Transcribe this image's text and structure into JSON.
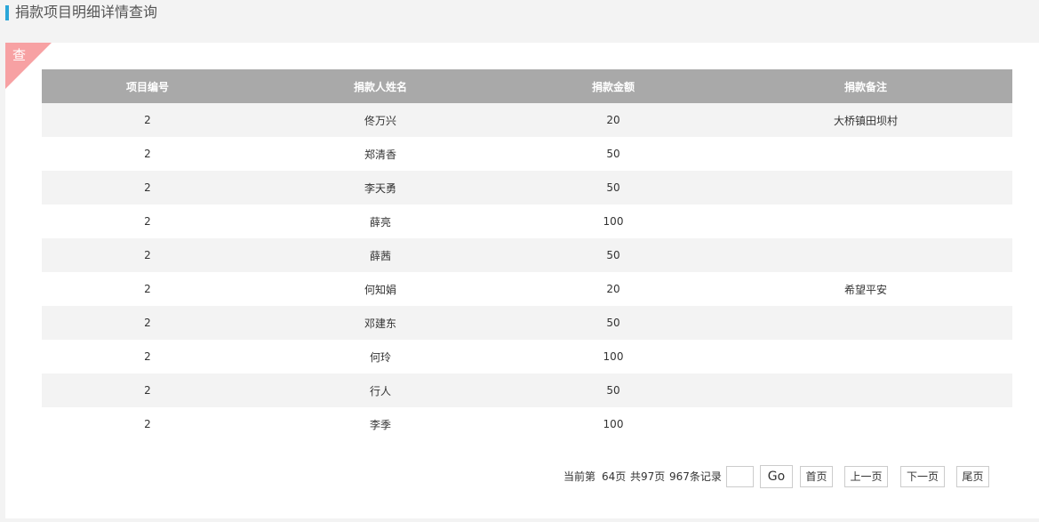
{
  "header": {
    "title": "捐款项目明细详情查询"
  },
  "panel": {
    "corner_label": "查"
  },
  "table": {
    "columns": [
      "项目编号",
      "捐款人姓名",
      "捐款金额",
      "捐款备注"
    ],
    "rows": [
      [
        "2",
        "佟万兴",
        "20",
        "大桥镇田坝村"
      ],
      [
        "2",
        "郑清香",
        "50",
        ""
      ],
      [
        "2",
        "李天勇",
        "50",
        ""
      ],
      [
        "2",
        "薛亮",
        "100",
        ""
      ],
      [
        "2",
        "薛茜",
        "50",
        ""
      ],
      [
        "2",
        "何知娟",
        "20",
        "希望平安"
      ],
      [
        "2",
        "邓建东",
        "50",
        ""
      ],
      [
        "2",
        "何玲",
        "100",
        ""
      ],
      [
        "2",
        "行人",
        "50",
        ""
      ],
      [
        "2",
        "李季",
        "100",
        ""
      ]
    ]
  },
  "pager": {
    "current_label": "当前第",
    "current_page": "64页",
    "total_pages": "共97页",
    "total_records": "967条记录",
    "page_input_value": "",
    "go_label": "Go",
    "first_label": "首页",
    "prev_label": "上一页",
    "next_label": "下一页",
    "last_label": "尾页"
  }
}
